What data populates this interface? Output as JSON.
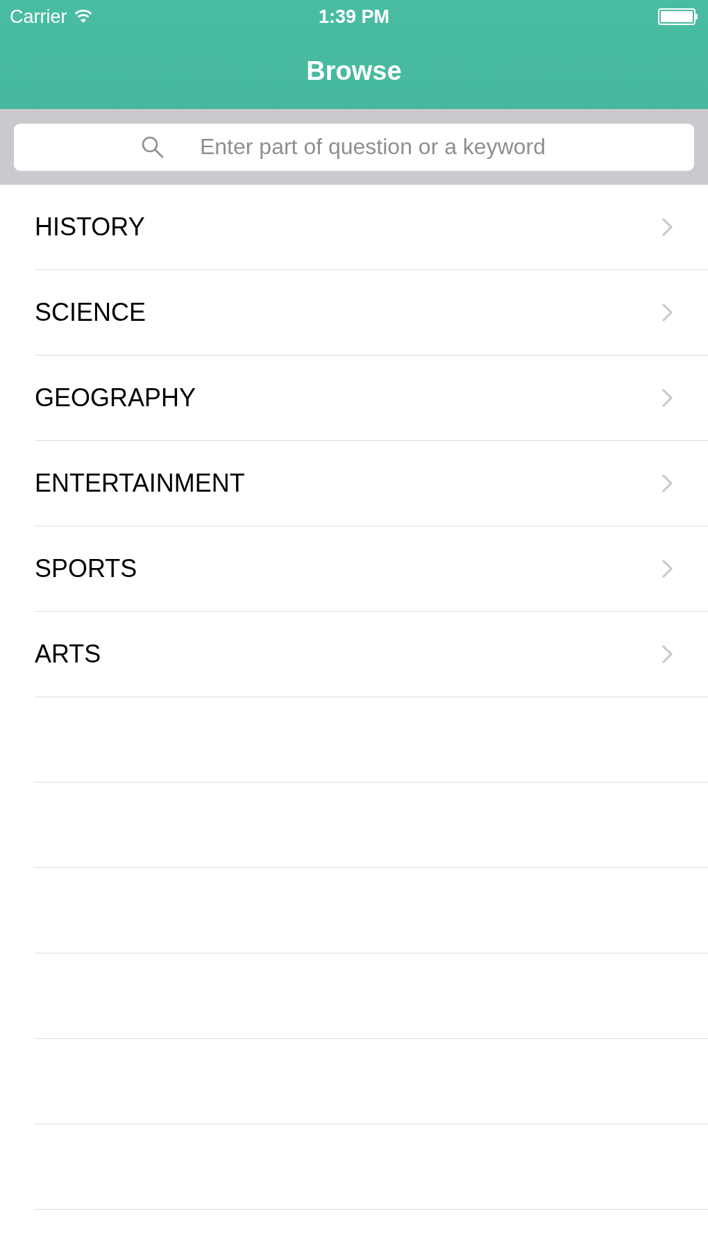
{
  "status_bar": {
    "carrier": "Carrier",
    "time": "1:39 PM"
  },
  "nav_bar": {
    "title": "Browse"
  },
  "search": {
    "placeholder": "Enter part of question or a keyword"
  },
  "categories": [
    {
      "label": "HISTORY"
    },
    {
      "label": "SCIENCE"
    },
    {
      "label": "GEOGRAPHY"
    },
    {
      "label": "ENTERTAINMENT"
    },
    {
      "label": "SPORTS"
    },
    {
      "label": "ARTS"
    }
  ]
}
